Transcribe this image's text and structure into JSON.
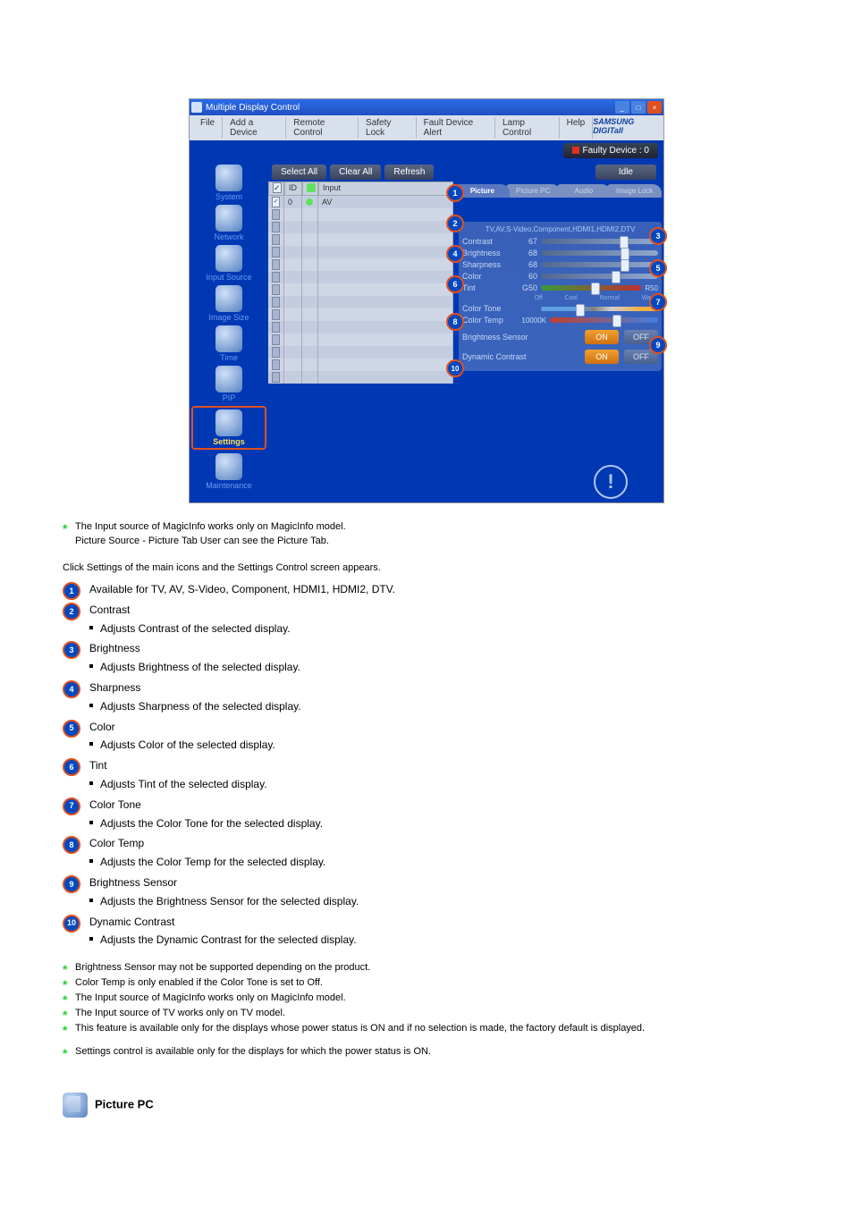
{
  "window": {
    "title": "Multiple Display Control"
  },
  "menubar": [
    "File",
    "Add a Device",
    "Remote Control",
    "Safety Lock",
    "Fault Device Alert",
    "Lamp Control",
    "Help"
  ],
  "samsung": "SAMSUNG DIGITall",
  "faulty": "Faulty Device : 0",
  "leftnav": [
    {
      "label": "System"
    },
    {
      "label": "Network"
    },
    {
      "label": "Input Source"
    },
    {
      "label": "Image Size"
    },
    {
      "label": "Time"
    },
    {
      "label": "PIP"
    },
    {
      "label": "Settings"
    },
    {
      "label": "Maintenance"
    }
  ],
  "midbtns": {
    "selectall": "Select All",
    "clearall": "Clear All",
    "refresh": "Refresh"
  },
  "idle": "Idle",
  "gridhdr": {
    "c2": "ID",
    "c4": "Input"
  },
  "gridrow": {
    "id": "0",
    "input": "AV"
  },
  "tabs": [
    "Picture",
    "Picture PC",
    "Audio",
    "Image Lock"
  ],
  "panelhdr": "TV,AV,S-Video,Component,HDMI1,HDMI2,DTV",
  "sliders": {
    "contrast": {
      "lbl": "Contrast",
      "val": "67"
    },
    "brightness": {
      "lbl": "Brightness",
      "val": "68"
    },
    "sharpness": {
      "lbl": "Sharpness",
      "val": "68"
    },
    "color": {
      "lbl": "Color",
      "val": "60"
    },
    "tint": {
      "lbl": "Tint",
      "lval": "G50",
      "rval": "R50"
    },
    "ctone": {
      "lbl": "Color Tone",
      "opts": [
        "Off",
        "Cool",
        "Normal",
        "Warm"
      ]
    },
    "ctemp": {
      "lbl": "Color Temp",
      "val": "10000K"
    }
  },
  "bsensor": {
    "lbl": "Brightness Sensor",
    "on": "ON",
    "off": "OFF"
  },
  "dcontrast": {
    "lbl": "Dynamic Contrast",
    "on": "ON",
    "off": "OFF"
  },
  "notes1": [
    "The Input source of MagicInfo works only on MagicInfo model.",
    "Picture Source - Picture Tab User can see the Picture Tab."
  ],
  "numlist": [
    {
      "t": "Available for TV, AV, S-Video, Component, HDMI1, HDMI2, DTV."
    },
    {
      "t": "Contrast",
      "subs": [
        "Adjusts Contrast of the selected display."
      ]
    },
    {
      "t": "Brightness",
      "subs": [
        "Adjusts Brightness of the selected display."
      ]
    },
    {
      "t": "Sharpness",
      "subs": [
        "Adjusts Sharpness of the selected display."
      ]
    },
    {
      "t": "Color",
      "subs": [
        "Adjusts Color of the selected display."
      ]
    },
    {
      "t": "Tint",
      "subs": [
        "Adjusts Tint of the selected display."
      ]
    },
    {
      "t": "Color Tone",
      "subs": [
        "Adjusts the Color Tone for the selected display."
      ]
    },
    {
      "t": "Color Temp",
      "subs": [
        "Adjusts the Color Temp for the selected display."
      ]
    },
    {
      "t": "Brightness Sensor",
      "subs": [
        "Adjusts the Brightness Sensor for the selected display."
      ]
    },
    {
      "t": "Dynamic Contrast",
      "subs": [
        "Adjusts the Dynamic Contrast for the selected display."
      ]
    }
  ],
  "fnotes": [
    "Brightness Sensor may not be supported depending on the product.",
    "Color Temp is only enabled if the Color Tone is set to Off.",
    "The Input source of MagicInfo works only on MagicInfo model.",
    "The Input source of TV works only on TV model.",
    "This feature is available only for the displays whose power status is ON and if no selection is made, the factory default is displayed.",
    "Settings control is available only for the displays for which the power status is ON."
  ],
  "secthead": "Picture PC",
  "section_intro": "Click Settings of the main icons and the Settings Control screen appears."
}
